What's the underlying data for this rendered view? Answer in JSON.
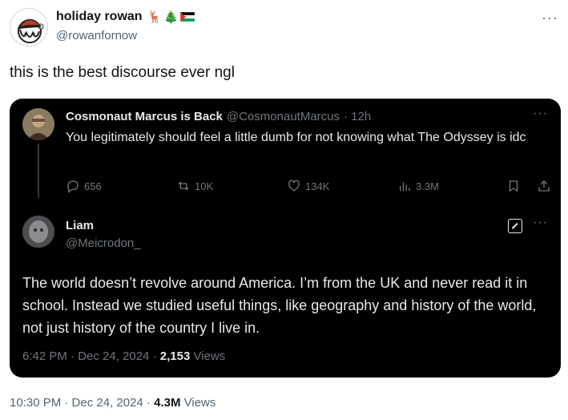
{
  "tweet": {
    "author_name": "holiday rowan",
    "author_emojis": [
      "🦌",
      "🎄"
    ],
    "author_handle": "@rowanfornow",
    "more_label": "···",
    "text": "this is the best discourse ever ngl",
    "time": "10:30 PM · Dec 24, 2024 · ",
    "views_count": "4.3M",
    "views_label": " Views"
  },
  "quoted": {
    "author_name": "Cosmonaut Marcus is Back",
    "author_handle": "@CosmonautMarcus",
    "age": "· 12h",
    "more_label": "···",
    "text": "You legitimately should feel a little dumb for not knowing what The Odyssey is idc",
    "replies": "656",
    "reposts": "10K",
    "likes": "134K",
    "views": "3.3M"
  },
  "reply": {
    "author_name": "Liam",
    "author_handle": "@Meicrodon_",
    "more_label": "···",
    "text": "The world doesn’t revolve around America.  I’m from the UK and never read it in school. Instead we studied useful things, like geography and history of the world, not just history of the country I live in.",
    "time": "6:42 PM · Dec 24, 2024 · ",
    "views_count": "2,153",
    "views_label": " Views"
  },
  "colors": {
    "card_bg": "#000000",
    "dark_text": "#e7e9ea",
    "dark_muted": "#71767b",
    "light_text": "#0f1419",
    "light_muted": "#536471"
  },
  "icons": [
    "reply-icon",
    "repost-icon",
    "like-icon",
    "views-icon",
    "bookmark-icon",
    "share-icon",
    "grok-icon",
    "more-icon",
    "palestine-flag-icon"
  ]
}
